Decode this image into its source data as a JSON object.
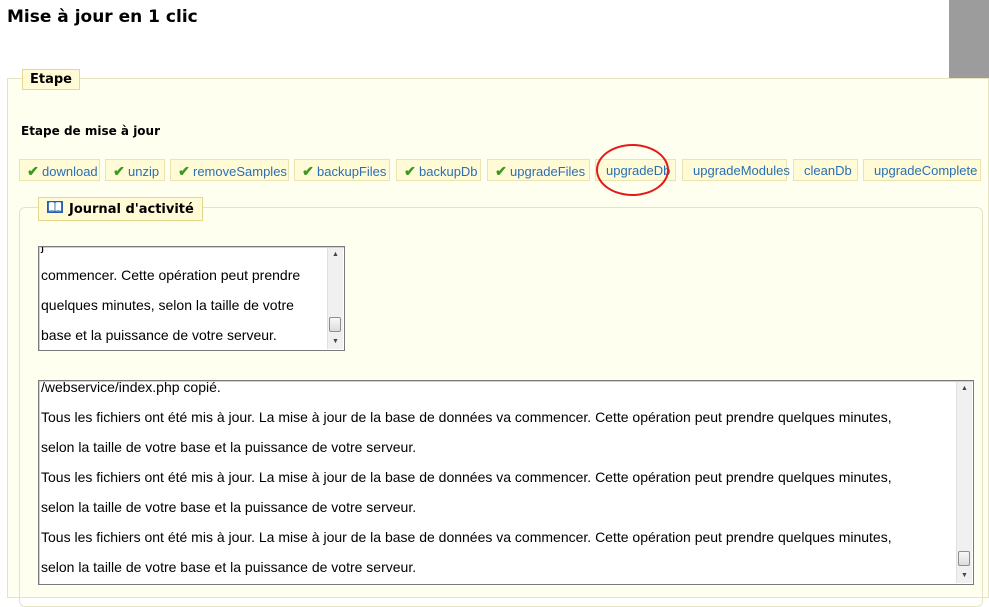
{
  "page": {
    "title": "Mise à jour en 1 clic"
  },
  "etape": {
    "legend": "Etape",
    "heading": "Etape de mise à jour",
    "steps": [
      {
        "label": "download",
        "done": true
      },
      {
        "label": "unzip",
        "done": true
      },
      {
        "label": "removeSamples",
        "done": true
      },
      {
        "label": "backupFiles",
        "done": true
      },
      {
        "label": "backupDb",
        "done": true
      },
      {
        "label": "upgradeFiles",
        "done": true
      },
      {
        "label": "upgradeDb",
        "done": false,
        "annotated": true
      },
      {
        "label": "upgradeModules",
        "done": false
      },
      {
        "label": "cleanDb",
        "done": false
      },
      {
        "label": "upgradeComplete",
        "done": false
      }
    ]
  },
  "journal": {
    "legend": "Journal d'activité",
    "icon": "book-icon",
    "small_log": [
      "j",
      "commencer. Cette opération peut prendre",
      "quelques minutes, selon la taille de votre",
      "base et la puissance de votre serveur."
    ],
    "main_log": [
      "/webservice/index.php copié.",
      "Tous les fichiers ont été mis à jour. La mise à jour de la base de données va commencer. Cette opération peut prendre quelques minutes,",
      "selon la taille de votre base et la puissance de votre serveur.",
      "Tous les fichiers ont été mis à jour. La mise à jour de la base de données va commencer. Cette opération peut prendre quelques minutes,",
      "selon la taille de votre base et la puissance de votre serveur.",
      "Tous les fichiers ont été mis à jour. La mise à jour de la base de données va commencer. Cette opération peut prendre quelques minutes,",
      "selon la taille de votre base et la puissance de votre serveur."
    ]
  },
  "colors": {
    "panel_bg": "#fffff0",
    "legend_bg": "#fffbd6",
    "link": "#2a6fb5",
    "check": "#3a9a1e",
    "annotation": "#e21a1a"
  }
}
